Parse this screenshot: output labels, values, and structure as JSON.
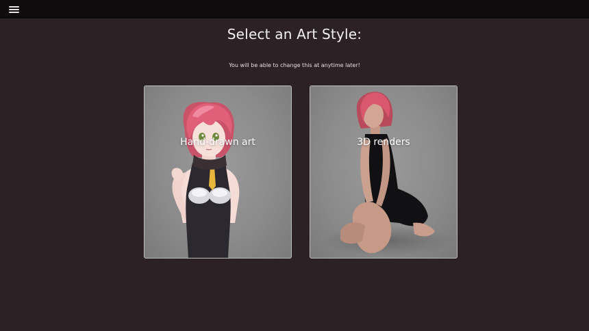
{
  "header": {
    "menu_icon": "hamburger-menu-icon"
  },
  "page": {
    "title": "Select an Art Style:",
    "subtitle": "You will be able to change this at anytime later!"
  },
  "styles": [
    {
      "label": "Hand-drawn art",
      "image": "anime-girl-illustration"
    },
    {
      "label": "3D renders",
      "image": "3d-render-kneeling-woman"
    }
  ],
  "colors": {
    "background": "#2c2226",
    "topbar": "#0f0c0d",
    "card": "#8f8f8f",
    "hair": "#e0607a"
  }
}
